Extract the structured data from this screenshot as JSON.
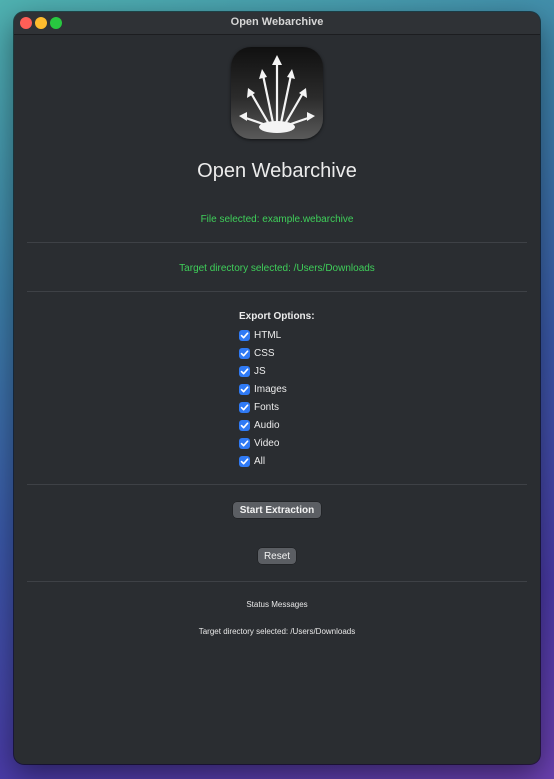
{
  "window": {
    "title": "Open Webarchive"
  },
  "app": {
    "name": "Open Webarchive"
  },
  "file_status": "File selected: example.webarchive",
  "target_status": "Target directory selected: /Users/Downloads",
  "export": {
    "label": "Export Options:",
    "options": [
      {
        "label": "HTML",
        "checked": true
      },
      {
        "label": "CSS",
        "checked": true
      },
      {
        "label": "JS",
        "checked": true
      },
      {
        "label": "Images",
        "checked": true
      },
      {
        "label": "Fonts",
        "checked": true
      },
      {
        "label": "Audio",
        "checked": true
      },
      {
        "label": "Video",
        "checked": true
      },
      {
        "label": "All",
        "checked": true
      }
    ]
  },
  "buttons": {
    "start": "Start Extraction",
    "reset": "Reset"
  },
  "status": {
    "heading": "Status Messages",
    "message": "Target directory selected: /Users/Downloads"
  },
  "colors": {
    "accent_green": "#3fcf5a",
    "checkbox_blue": "#2f7af5",
    "window_bg": "#2a2d31"
  }
}
